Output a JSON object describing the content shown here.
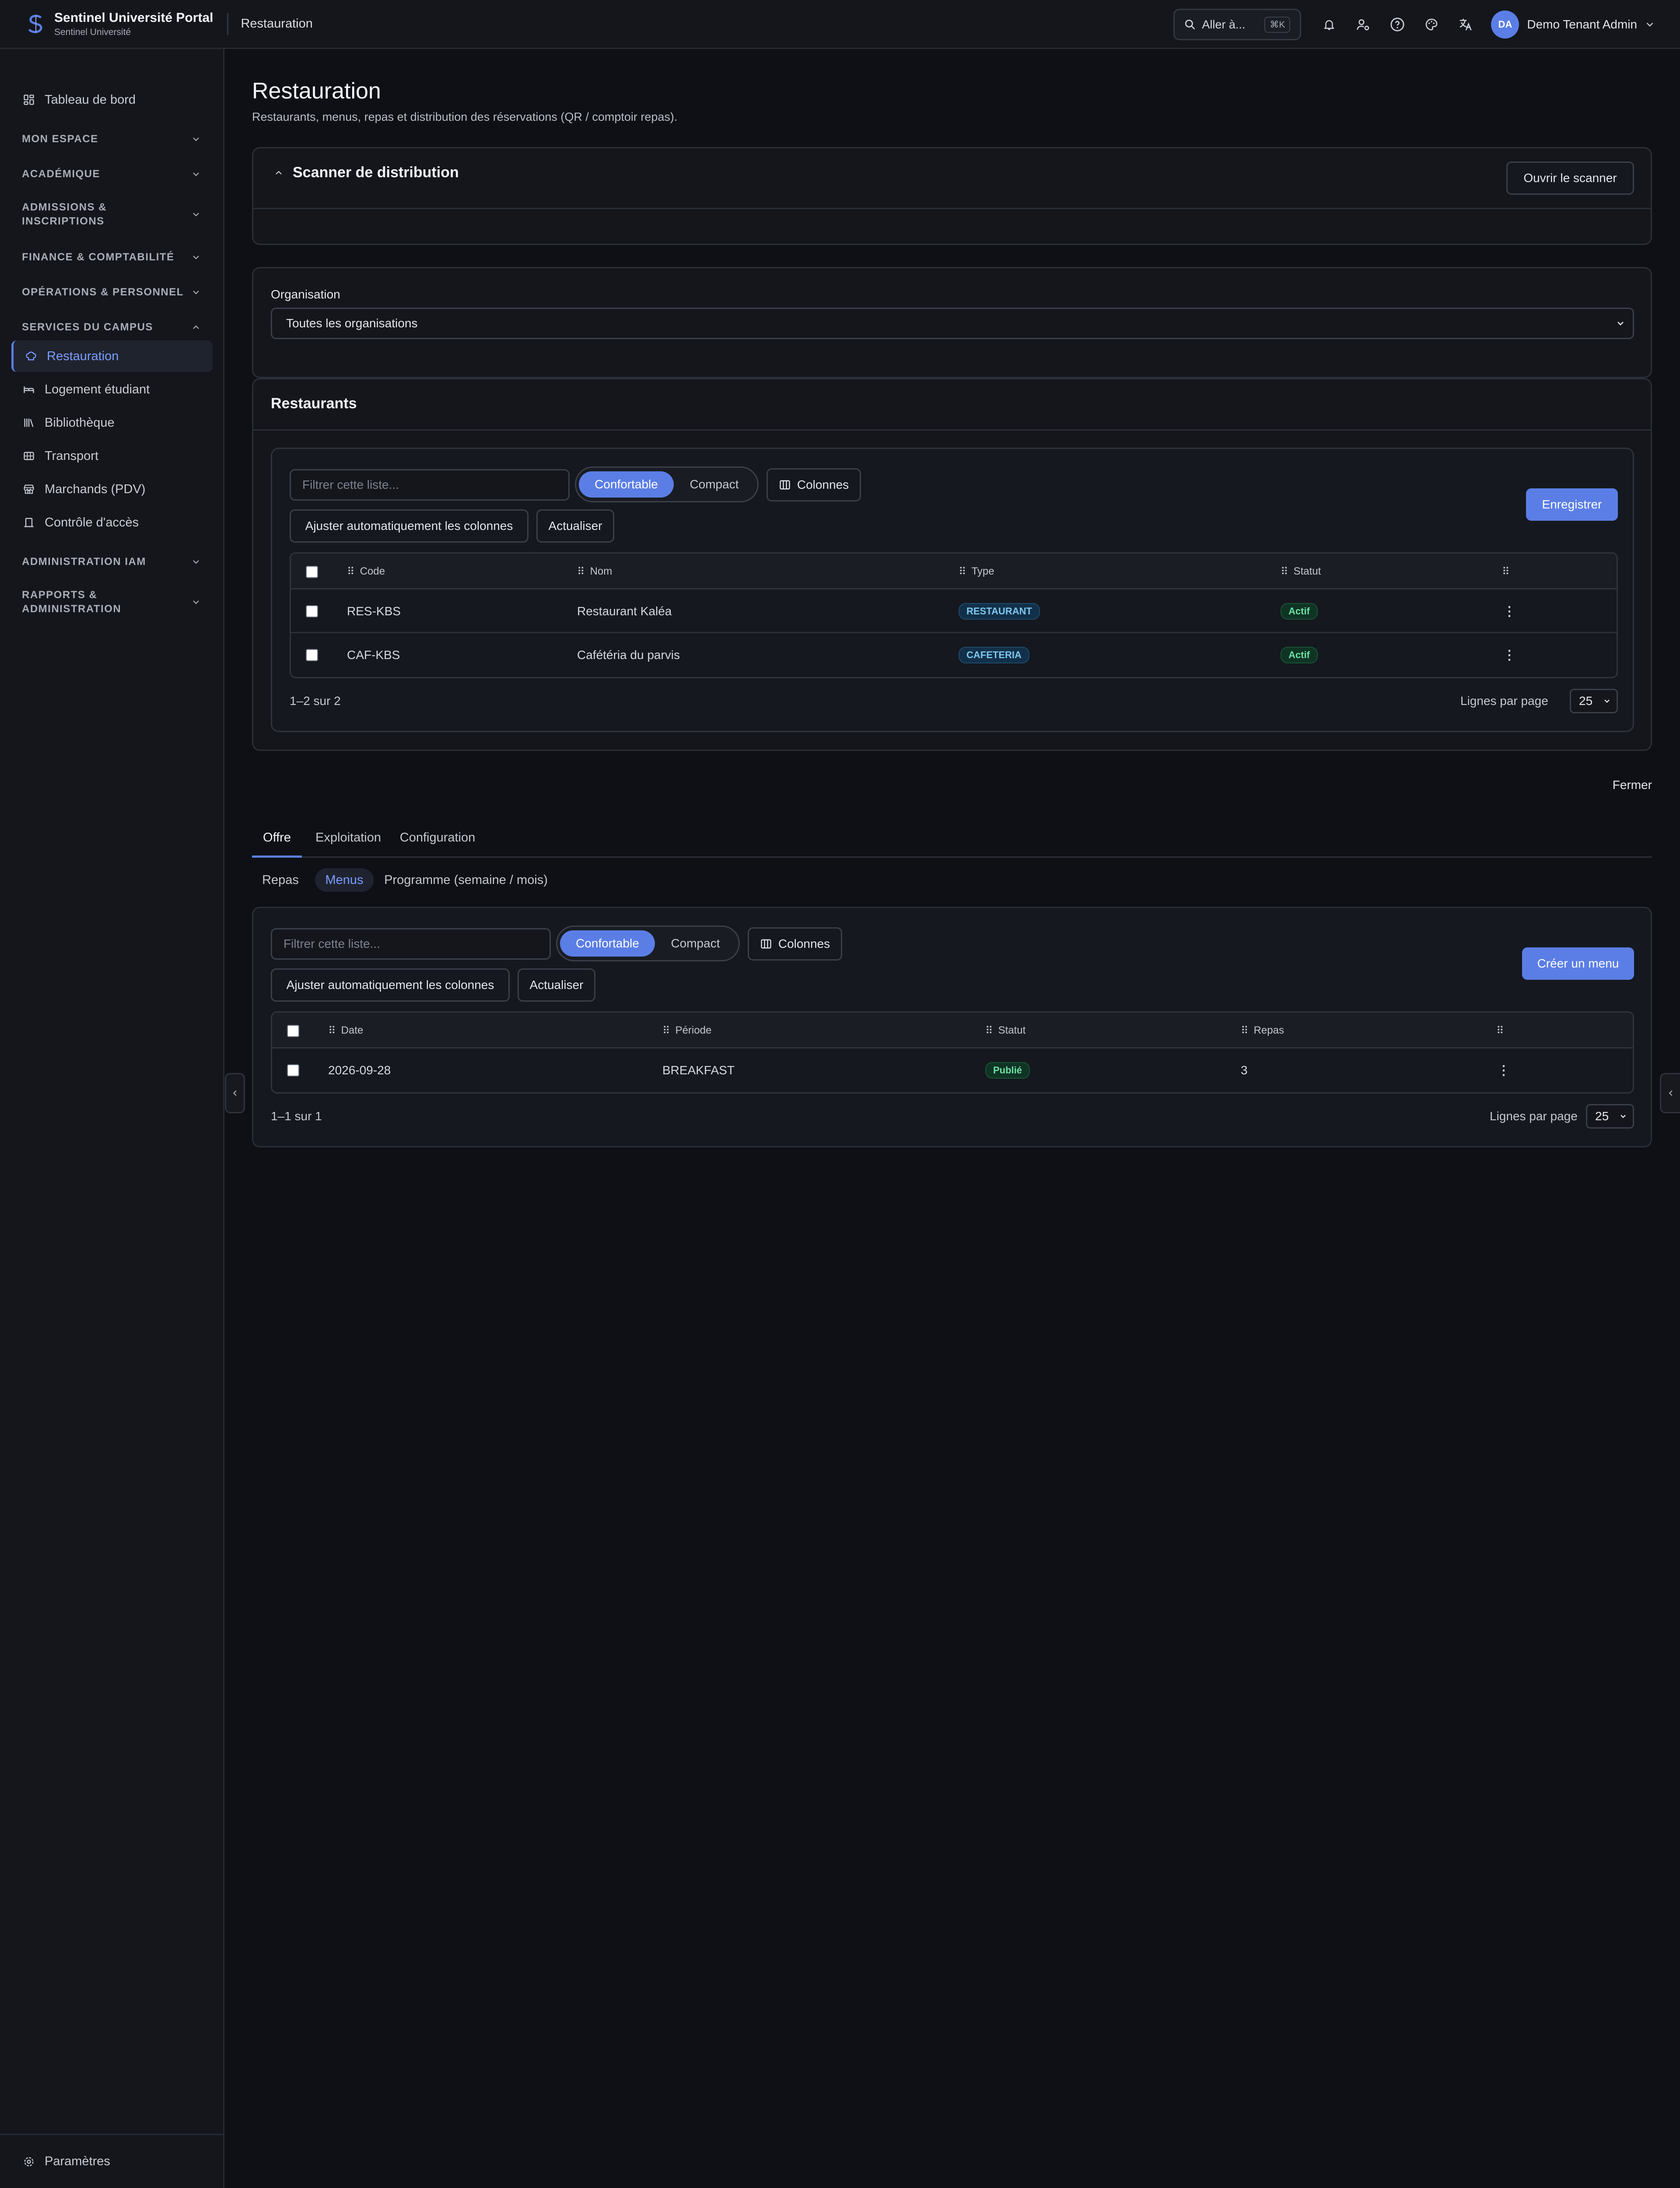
{
  "brand": {
    "name": "Sentinel Université Portal",
    "sub": "Sentinel Université"
  },
  "topbar": {
    "crumb": "Restauration",
    "search_placeholder": "Aller à...",
    "search_kbd": "⌘K",
    "avatar": "DA",
    "user_name": "Demo Tenant Admin"
  },
  "sidebar": {
    "dashboard": "Tableau de bord",
    "sections": {
      "mon_espace": "MON ESPACE",
      "academique": "ACADÉMIQUE",
      "admissions_1": "ADMISSIONS &",
      "admissions_2": "INSCRIPTIONS",
      "finance": "FINANCE & COMPTABILITÉ",
      "operations": "OPÉRATIONS & PERSONNEL",
      "services": "SERVICES DU CAMPUS",
      "iam": "ADMINISTRATION IAM",
      "rapports_1": "RAPPORTS &",
      "rapports_2": "ADMINISTRATION"
    },
    "items": {
      "restauration": "Restauration",
      "logement": "Logement étudiant",
      "bibliotheque": "Bibliothèque",
      "transport": "Transport",
      "marchands": "Marchands (PDV)",
      "controle": "Contrôle d'accès"
    },
    "settings": "Paramètres"
  },
  "page": {
    "title": "Restauration",
    "description": "Restaurants, menus, repas et distribution des réservations (QR / comptoir repas)."
  },
  "scanner": {
    "title": "Scanner de distribution",
    "open_button": "Ouvrir le scanner"
  },
  "organisation": {
    "label": "Organisation",
    "value": "Toutes les organisations"
  },
  "restaurants": {
    "title": "Restaurants",
    "filter_placeholder": "Filtrer cette liste...",
    "density_comfortable": "Confortable",
    "density_compact": "Compact",
    "columns_button": "Colonnes",
    "autofit_button": "Ajuster automatiquement les colonnes",
    "refresh_button": "Actualiser",
    "primary_button": "Enregistrer",
    "headers": {
      "code": "Code",
      "nom": "Nom",
      "type": "Type",
      "statut": "Statut"
    },
    "rows": [
      {
        "code": "RES-KBS",
        "nom": "Restaurant Kaléa",
        "type": "RESTAURANT",
        "statut": "Actif"
      },
      {
        "code": "CAF-KBS",
        "nom": "Cafétéria du parvis",
        "type": "CAFETERIA",
        "statut": "Actif"
      }
    ],
    "range": "1–2 sur 2",
    "rows_per_page_label": "Lignes par page",
    "rows_per_page": "25"
  },
  "close_label": "Fermer",
  "tabs": {
    "offre": "Offre",
    "exploitation": "Exploitation",
    "configuration": "Configuration"
  },
  "subtabs": {
    "repas": "Repas",
    "menus": "Menus",
    "programme": "Programme (semaine / mois)"
  },
  "menus": {
    "filter_placeholder": "Filtrer cette liste...",
    "density_comfortable": "Confortable",
    "density_compact": "Compact",
    "columns_button": "Colonnes",
    "autofit_button": "Ajuster automatiquement les colonnes",
    "refresh_button": "Actualiser",
    "primary_button": "Créer un menu",
    "headers": {
      "date": "Date",
      "periode": "Période",
      "statut": "Statut",
      "repas": "Repas"
    },
    "rows": [
      {
        "date": "2026-09-28",
        "periode": "BREAKFAST",
        "statut": "Publié",
        "repas": "3"
      }
    ],
    "range": "1–1 sur 1",
    "rows_per_page_label": "Lignes par page",
    "rows_per_page": "25"
  },
  "colors": {
    "accent": "#5b7ee6",
    "background": "#0e1015",
    "surface": "#14161c"
  }
}
